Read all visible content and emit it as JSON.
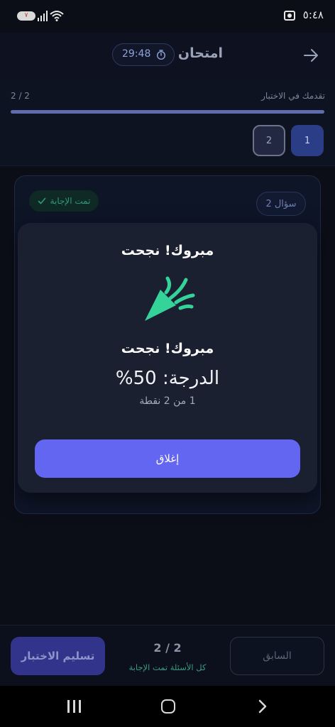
{
  "status_bar": {
    "time": "٥:٤٨",
    "battery": "٧"
  },
  "header": {
    "title": "امتحان",
    "timer": "29:48"
  },
  "progress": {
    "label": "تقدمك في الاختبار",
    "count": "2 / 2",
    "fraction": 1.0
  },
  "question_numbers": [
    "1",
    "2"
  ],
  "question_card": {
    "badge": "سؤال 2",
    "answered": "تمت الإجابة"
  },
  "modal": {
    "title": "مبروك! نجحت",
    "heading": "مبروك! نجحت",
    "score": "الدرجة: 50%",
    "points": "1 من 2 نقطة",
    "close_label": "إغلاق"
  },
  "bottom_bar": {
    "submit_label": "تسليم الاختبار",
    "count": "2 / 2",
    "status": "كل الأسئلة تمت الإجابة",
    "prev_label": "السابق"
  },
  "colors": {
    "accent": "#6366f1",
    "success": "#34d399",
    "background": "#0b0e17"
  }
}
